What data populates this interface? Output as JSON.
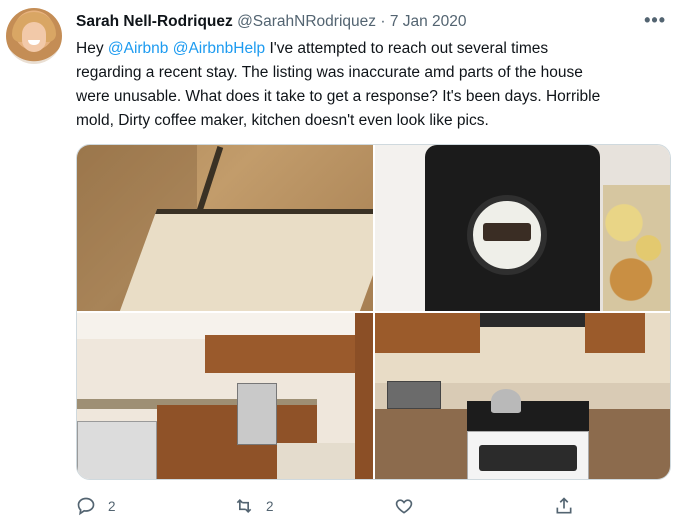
{
  "tweet": {
    "author_name": "Sarah Nell-Rodriquez",
    "handle": "@SarahNRodriquez",
    "separator": "·",
    "date": "7 Jan 2020",
    "more_label": "•••",
    "text": {
      "line1_prefix": "Hey ",
      "mention1": "@Airbnb",
      "line1_space": " ",
      "mention2": "@AirbnbHelp",
      "line1_suffix": " I've attempted to reach out several times",
      "line2": "regarding a recent stay. The listing was inaccurate amd parts of the house",
      "line3": "were unusable. What does it take to get a response? It's been days. Horrible",
      "line4": "mold, Dirty coffee maker, kitchen doesn't even look like pics."
    },
    "media": [
      {
        "subject": "moldy tub corner"
      },
      {
        "subject": "dirty coffee maker"
      },
      {
        "subject": "kitchen overview"
      },
      {
        "subject": "stove and counter"
      }
    ],
    "actions": {
      "reply_count": "2",
      "retweet_count": "2",
      "like_count": "",
      "share_count": ""
    }
  },
  "colors": {
    "accent": "#1d9bf0",
    "secondary_text": "#536471",
    "primary_text": "#0f1419"
  },
  "icons": [
    "avatar",
    "more-icon",
    "reply-icon",
    "retweet-icon",
    "like-icon",
    "share-icon"
  ]
}
